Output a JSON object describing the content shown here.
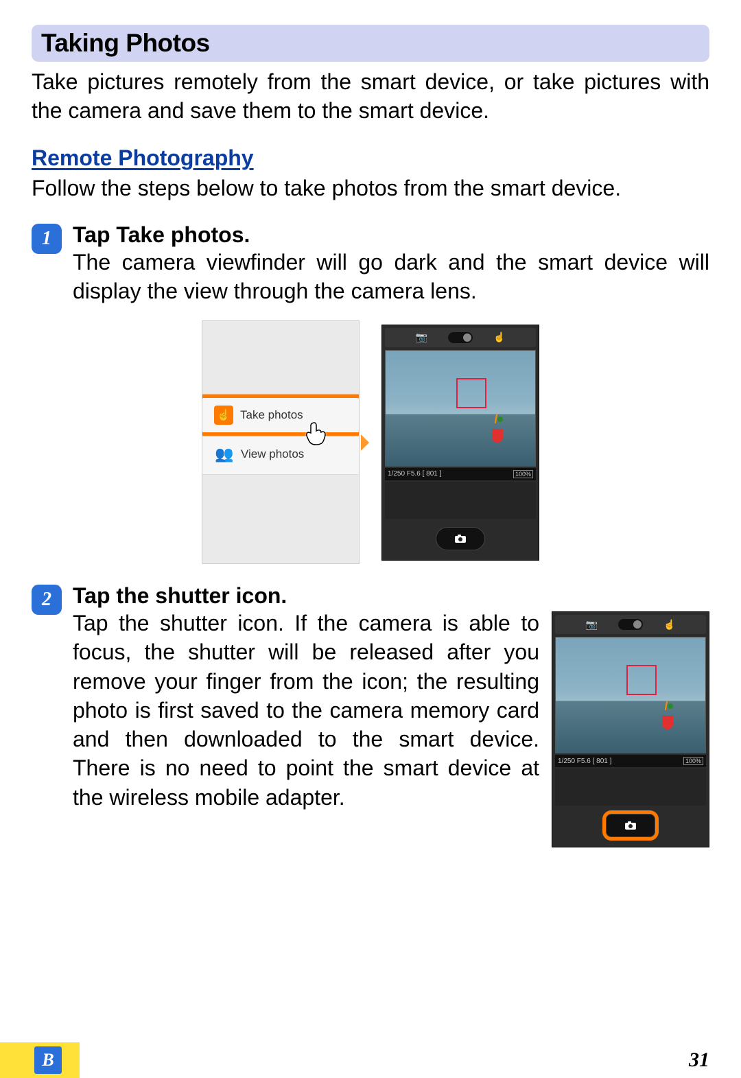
{
  "section": {
    "title": "Taking Photos"
  },
  "intro": "Take pictures remotely from the smart device, or take pictures with the camera and save them to the smart device.",
  "subsection": {
    "heading": "Remote Photography",
    "text": "Follow the steps below to take photos from the smart device."
  },
  "step1": {
    "num": "1",
    "title_pre": "Tap ",
    "title_bold": "Take photos",
    "title_post": ".",
    "text": "The camera viewfinder will go dark and the smart device will display the view through the camera lens."
  },
  "menu": {
    "take": "Take photos",
    "view": "View photos"
  },
  "viewfinder": {
    "info_left": "1/250  F5.6  [ 801 ]",
    "info_right": "100%"
  },
  "step2": {
    "num": "2",
    "title": "Tap the shutter icon.",
    "text": "Tap the shutter icon. If the camera is able to focus, the shutter will be released after you remove your finger from the icon; the resulting photo is first saved to the camera memory card and then downloaded to the smart device. There is no need to point the smart device at the wireless mobile adapter."
  },
  "footer": {
    "section_letter": "B",
    "page": "31"
  }
}
